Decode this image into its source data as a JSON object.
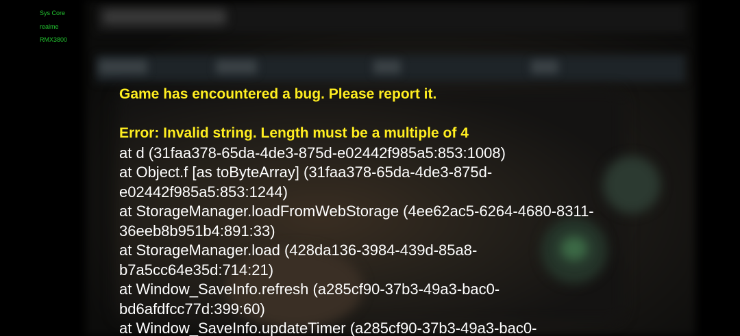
{
  "sysinfo": {
    "line1": "Sys Core",
    "line2": "realme",
    "line3": "RMX3800"
  },
  "error": {
    "headline": "Game has encountered a bug. Please report it.",
    "message": "Error: Invalid string. Length must be a multiple of 4",
    "stack_lines": [
      "at d (31faa378-65da-4de3-875d-e02442f985a5:853:1008)",
      "at Object.f [as toByteArray] (31faa378-65da-4de3-875d-",
      "e02442f985a5:853:1244)",
      "at StorageManager.loadFromWebStorage (4ee62ac5-6264-4680-8311-",
      "36eeb8b951b4:891:33)",
      "at StorageManager.load (428da136-3984-439d-85a8-",
      "b7a5cc64e35d:714:21)",
      "at Window_SaveInfo.refresh (a285cf90-37b3-49a3-bac0-",
      "bd6afdfcc77d:399:60)",
      "at Window_SaveInfo.updateTimer (a285cf90-37b3-49a3-bac0-"
    ]
  },
  "colors": {
    "background": "#000000",
    "sysinfo_text": "#22c32f",
    "headline_text": "#ffee20",
    "stack_text": "#ffffff"
  }
}
